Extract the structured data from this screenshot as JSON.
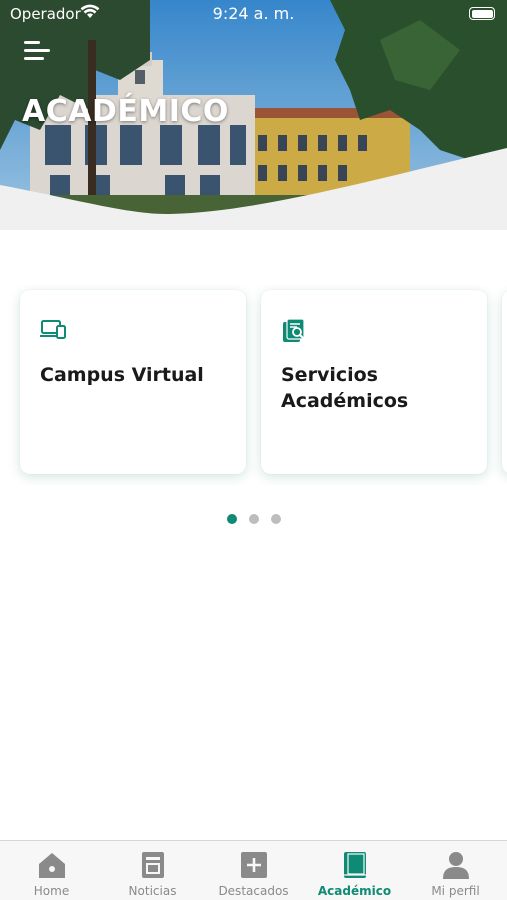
{
  "status_bar": {
    "carrier": "Operador",
    "time": "9:24 a. m."
  },
  "header": {
    "title": "ACADÉMICO"
  },
  "cards": [
    {
      "label": "Campus Virtual",
      "icon": "laptop-phone-icon"
    },
    {
      "label": "Servicios Académicos",
      "icon": "document-search-icon"
    }
  ],
  "pager": {
    "count": 3,
    "active_index": 0
  },
  "tabbar": {
    "items": [
      {
        "label": "Home",
        "icon": "home-icon"
      },
      {
        "label": "Noticias",
        "icon": "newspaper-icon"
      },
      {
        "label": "Destacados",
        "icon": "plus-square-icon"
      },
      {
        "label": "Académico",
        "icon": "book-icon",
        "active": true
      },
      {
        "label": "Mi perfil",
        "icon": "user-icon"
      }
    ]
  },
  "colors": {
    "accent": "#0f8a75",
    "inactive": "#8a8a8a",
    "tabbar_bg": "#f7f7f7"
  }
}
